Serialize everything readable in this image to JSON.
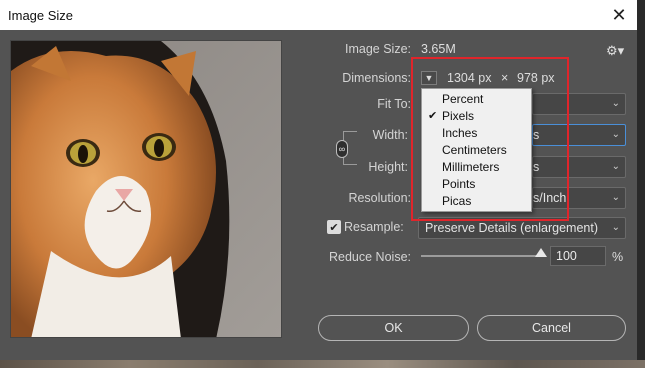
{
  "window": {
    "title": "Image Size"
  },
  "info": {
    "image_size_label": "Image Size:",
    "image_size_value": "3.65M"
  },
  "dimensions": {
    "label": "Dimensions:",
    "width": "1304 px",
    "times": "×",
    "height": "978 px"
  },
  "fit_to": {
    "label": "Fit To:"
  },
  "width": {
    "label": "Width:",
    "unit_fragment": "s"
  },
  "height": {
    "label": "Height:",
    "unit_fragment": "s"
  },
  "resolution": {
    "label": "Resolution:",
    "unit_fragment": "s/Inch"
  },
  "resample": {
    "label": "Resample:",
    "checked": true,
    "value": "Preserve Details (enlargement)"
  },
  "reduce_noise": {
    "label": "Reduce Noise:",
    "value": "100",
    "unit": "%",
    "level_fraction": 1.0
  },
  "unit_menu": {
    "items": [
      {
        "label": "Percent",
        "selected": false
      },
      {
        "label": "Pixels",
        "selected": true
      },
      {
        "label": "Inches",
        "selected": false
      },
      {
        "label": "Centimeters",
        "selected": false
      },
      {
        "label": "Millimeters",
        "selected": false
      },
      {
        "label": "Points",
        "selected": false
      },
      {
        "label": "Picas",
        "selected": false
      }
    ]
  },
  "buttons": {
    "ok": "OK",
    "cancel": "Cancel"
  },
  "icons": {
    "close": "close-icon",
    "gear": "gear-icon",
    "link": "link-icon",
    "check": "checkmark-icon"
  },
  "colors": {
    "highlight": "#e0252b",
    "focus": "#4a8fd8",
    "dialog_bg": "#535353"
  }
}
